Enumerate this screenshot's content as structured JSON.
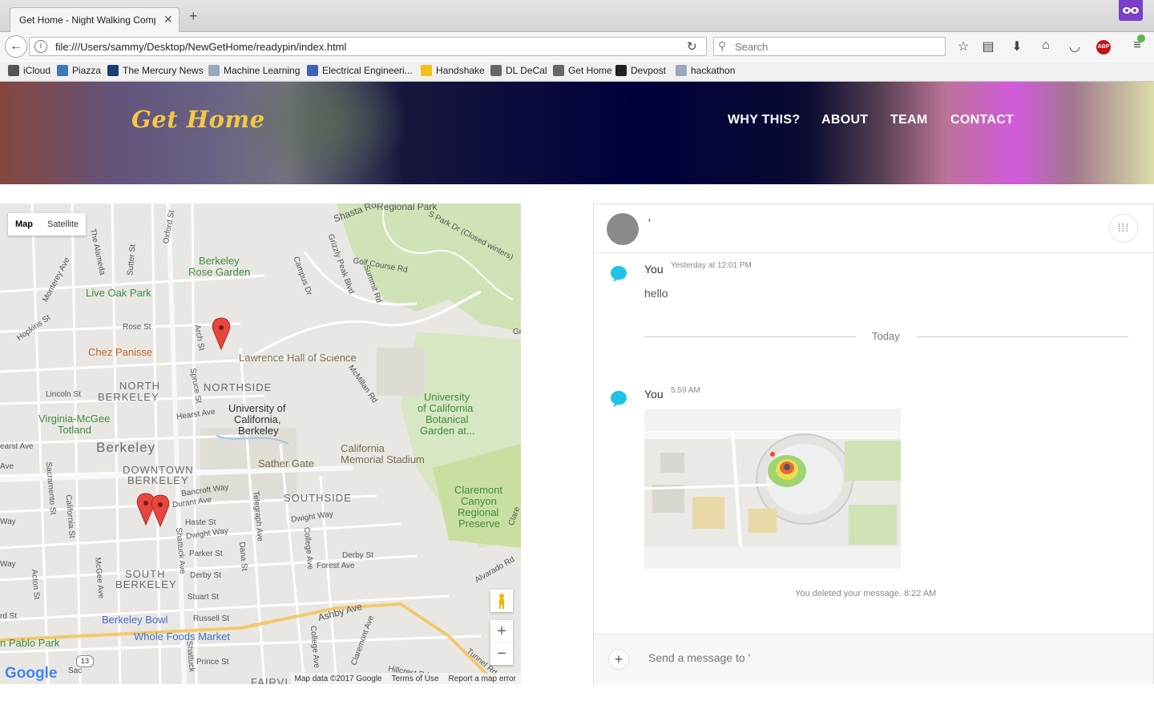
{
  "browser": {
    "tab_title": "Get Home - Night Walking Compa",
    "tab_close": "✕",
    "new_tab": "+",
    "url": "file:///Users/sammy/Desktop/NewGetHome/readypin/index.html",
    "search_placeholder": "Search",
    "toolbar_icons": [
      "star-icon",
      "reading-list-icon",
      "download-icon",
      "home-icon",
      "pocket-icon",
      "adblock-icon",
      "menu-icon"
    ],
    "adblock_label": "ABP",
    "bookmarks": [
      {
        "label": "iCloud",
        "icon": "apple-icon",
        "color": "#555555"
      },
      {
        "label": "Piazza",
        "icon": "piazza-icon",
        "color": "#3c78b4"
      },
      {
        "label": "The Mercury News",
        "icon": "mercury-icon",
        "color": "#1d3b73"
      },
      {
        "label": "Machine Learning",
        "icon": "folder-icon",
        "color": "#9aa7b8"
      },
      {
        "label": "Electrical Engineeri...",
        "icon": "rss-icon",
        "color": "#3d63b8"
      },
      {
        "label": "Handshake",
        "icon": "handshake-icon",
        "color": "#f2c21b"
      },
      {
        "label": "DL DeCal",
        "icon": "globe-icon",
        "color": "#666666"
      },
      {
        "label": "Get Home",
        "icon": "globe-icon",
        "color": "#666666"
      },
      {
        "label": "Devpost",
        "icon": "devpost-icon",
        "color": "#222222"
      },
      {
        "label": "hackathon",
        "icon": "folder-icon",
        "color": "#9aa7b8"
      }
    ]
  },
  "site": {
    "logo": "Get Home",
    "nav": [
      "WHY THIS?",
      "ABOUT",
      "TEAM",
      "CONTACT"
    ]
  },
  "map": {
    "type_buttons": [
      "Map",
      "Satellite"
    ],
    "labels": {
      "shasta": "Shasta Rd",
      "regional": "Regional Park",
      "spark": "S Park Dr (Closed winters)",
      "berkeley_rose": "Berkeley",
      "berkeley_rose2": "Rose Garden",
      "live_oak": "Live Oak Park",
      "chez": "Chez Panisse",
      "lawrence": "Lawrence Hall of Science",
      "north_berkeley": "NORTH",
      "north_berkeley2": "BERKELEY",
      "northside": "NORTHSIDE",
      "uc": "University of",
      "uc2": "California,",
      "uc3": "Berkeley",
      "ucbg": "University",
      "ucbg2": "of California",
      "ucbg3": "Botanical",
      "ucbg4": "Garden at...",
      "virginia": "Virginia-McGee",
      "virginia2": "Totland",
      "berkeley": "Berkeley",
      "downtown": "DOWNTOWN",
      "downtown2": "BERKELEY",
      "cms": "California",
      "cms2": "Memorial Stadium",
      "sather": "Sather Gate",
      "southside": "SOUTHSIDE",
      "claremont": "Claremont",
      "claremont2": "Canyon",
      "claremont3": "Regional",
      "claremont4": "Preserve",
      "south_berkeley": "SOUTH",
      "south_berkeley2": "BERKELEY",
      "bowl": "Berkeley Bowl",
      "whole": "Whole Foods Market",
      "ashby": "Ashby Ave",
      "pablo": "n Pablo Park",
      "fairview": "FAIRVII",
      "hopkins": "Hopkins St",
      "rose": "Rose St",
      "lincoln": "Lincoln St",
      "hearst": "Hearst Ave",
      "bancroft": "Bancroft Way",
      "durant": "Durant Ave",
      "haste": "Haste St",
      "dwight": "Dwight Way",
      "dwight2": "Dwight Way",
      "parker": "Parker St",
      "derby": "Derby St",
      "derby2": "Derby St",
      "stuart": "Stuart St",
      "russell": "Russell St",
      "prince": "Prince St",
      "forest": "Forest Ave",
      "alvarado": "Alvarado Rd",
      "hillcrest": "Hillcrest Rd",
      "tunnel": "Tunnel Rd",
      "golf": "Golf Course Rd",
      "grizzly": "Grizzly Peak Blvd",
      "summit": "Summit Rd",
      "campus": "Campus Dr",
      "mcmillan": "McMillan Rd",
      "oxford": "Oxford St",
      "alameda": "The Alameda",
      "sutter": "Sutter St",
      "monterey": "Monterey Ave",
      "arch": "Arch St",
      "spruce": "Spruce St",
      "sacramento": "Sacramento St",
      "california": "California St",
      "mcgee": "McGee Ave",
      "acton": "Acton St",
      "shattuck": "Shattuck Ave",
      "shattuck2": "Shattuck",
      "telegraph": "Telegraph Ave",
      "dana": "Dana St",
      "college": "College Ave",
      "college2": "College Ave",
      "claremont_ave": "Claremont Ave",
      "way": "Way",
      "ave": "Ave",
      "earst": "earst Ave",
      "rdst": "rd St",
      "way2": "Way",
      "sac": "Sac",
      "gr": "Gr",
      "clare": "Clare"
    },
    "route_shield": "13",
    "zoom_in": "+",
    "zoom_out": "−",
    "google": "Google",
    "footer": [
      "Map data ©2017 Google",
      "Terms of Use",
      "Report a map error"
    ]
  },
  "chat": {
    "contact_name": "'",
    "menu_icon": "grid-icon",
    "messages": [
      {
        "sender": "You",
        "time": "Yesterday at 12:01 PM",
        "text": "hello"
      },
      {
        "sender": "You",
        "time": "5:59 AM",
        "attachment": "map-screenshot"
      }
    ],
    "day_divider": "Today",
    "deleted_notice": "You deleted your message. 8:22 AM",
    "composer_placeholder": "Send a message to '",
    "plus": "+",
    "accent": "#1ec3e6"
  }
}
